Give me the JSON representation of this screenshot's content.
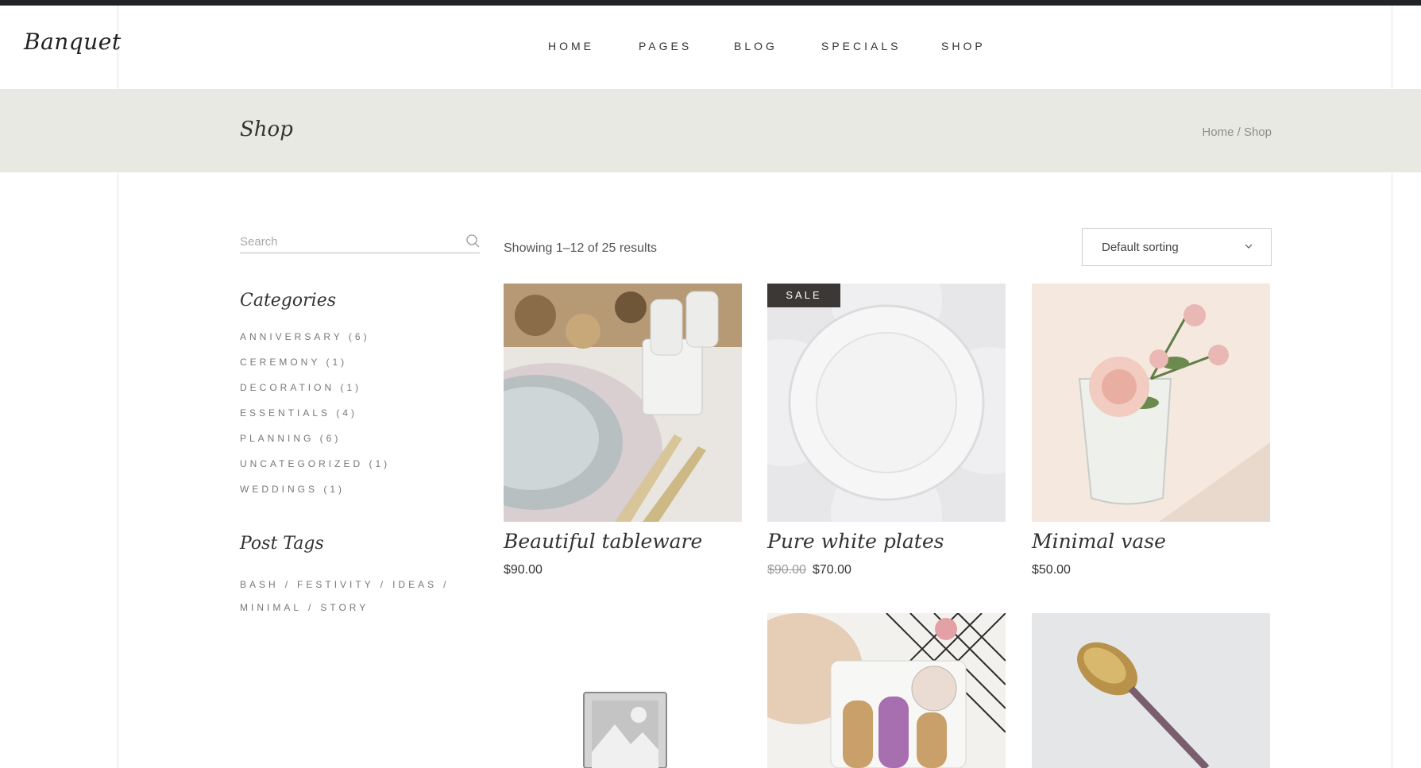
{
  "site": {
    "logo": "Banquet"
  },
  "nav": {
    "items": [
      "HOME",
      "PAGES",
      "BLOG",
      "SPECIALS",
      "SHOP"
    ]
  },
  "title_band": {
    "title": "Shop",
    "breadcrumb": {
      "home": "Home",
      "separator": " / ",
      "current": "Shop"
    }
  },
  "sidebar": {
    "search_placeholder": "Search",
    "categories_title": "Categories",
    "categories": [
      "ANNIVERSARY (6)",
      "CEREMONY (1)",
      "DECORATION (1)",
      "ESSENTIALS (4)",
      "PLANNING (6)",
      "UNCATEGORIZED (1)",
      "WEDDINGS (1)"
    ],
    "tags_title": "Post Tags",
    "tags": [
      "BASH",
      "FESTIVITY",
      "IDEAS",
      "MINIMAL",
      "STORY"
    ],
    "tag_separator": "/"
  },
  "shop": {
    "result_count": "Showing 1–12 of 25 results",
    "sorting": "Default sorting",
    "products": [
      {
        "name": "Beautiful tableware",
        "price": "$90.00",
        "old_price": "",
        "sale": ""
      },
      {
        "name": "Pure white plates",
        "price": "$70.00",
        "old_price": "$90.00",
        "sale": "SALE"
      },
      {
        "name": "Minimal vase",
        "price": "$50.00",
        "old_price": "",
        "sale": ""
      }
    ]
  },
  "colors": {
    "top_bar": "#202428",
    "title_band": "#e8e9e3",
    "sale_badge": "#3b3835"
  }
}
